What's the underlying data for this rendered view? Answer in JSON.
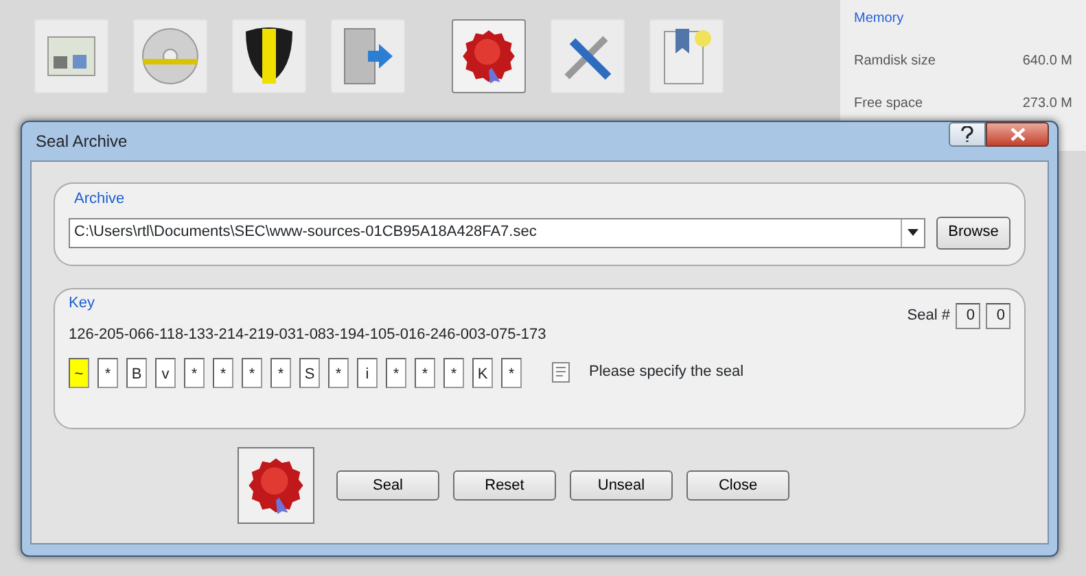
{
  "background": {
    "toolbar": [
      {
        "kind": "screen",
        "selected": false
      },
      {
        "kind": "disc",
        "selected": false
      },
      {
        "kind": "shield",
        "selected": false
      },
      {
        "kind": "door",
        "selected": false
      },
      {
        "kind": "seal",
        "selected": true
      },
      {
        "kind": "tools",
        "selected": false
      },
      {
        "kind": "bookmark",
        "selected": false
      }
    ],
    "memory": {
      "title": "Memory",
      "rows": [
        {
          "label": "Ramdisk size",
          "value": "640.0 M"
        },
        {
          "label": "Free space",
          "value": "273.0 M"
        }
      ]
    }
  },
  "dialog": {
    "title": "Seal Archive",
    "archive": {
      "label": "Archive",
      "path": "C:\\Users\\rtl\\Documents\\SEC\\www-sources-01CB95A18A428FA7.sec",
      "browse": "Browse"
    },
    "key": {
      "label": "Key",
      "code": "126-205-066-118-133-214-219-031-083-194-105-016-246-003-075-173",
      "seal_label": "Seal #",
      "seal_numbers": [
        "0",
        "0"
      ],
      "chars": [
        {
          "char": "~",
          "selected": true
        },
        {
          "char": "*",
          "selected": false
        },
        {
          "char": "B",
          "selected": false
        },
        {
          "char": "v",
          "selected": false
        },
        {
          "char": "*",
          "selected": false
        },
        {
          "char": "*",
          "selected": false
        },
        {
          "char": "*",
          "selected": false
        },
        {
          "char": "*",
          "selected": false
        },
        {
          "char": "S",
          "selected": false
        },
        {
          "char": "*",
          "selected": false
        },
        {
          "char": "i",
          "selected": false
        },
        {
          "char": "*",
          "selected": false
        },
        {
          "char": "*",
          "selected": false
        },
        {
          "char": "*",
          "selected": false
        },
        {
          "char": "K",
          "selected": false
        },
        {
          "char": "*",
          "selected": false
        }
      ],
      "hint": "Please specify the seal"
    },
    "buttons": [
      "Seal",
      "Reset",
      "Unseal",
      "Close"
    ]
  }
}
